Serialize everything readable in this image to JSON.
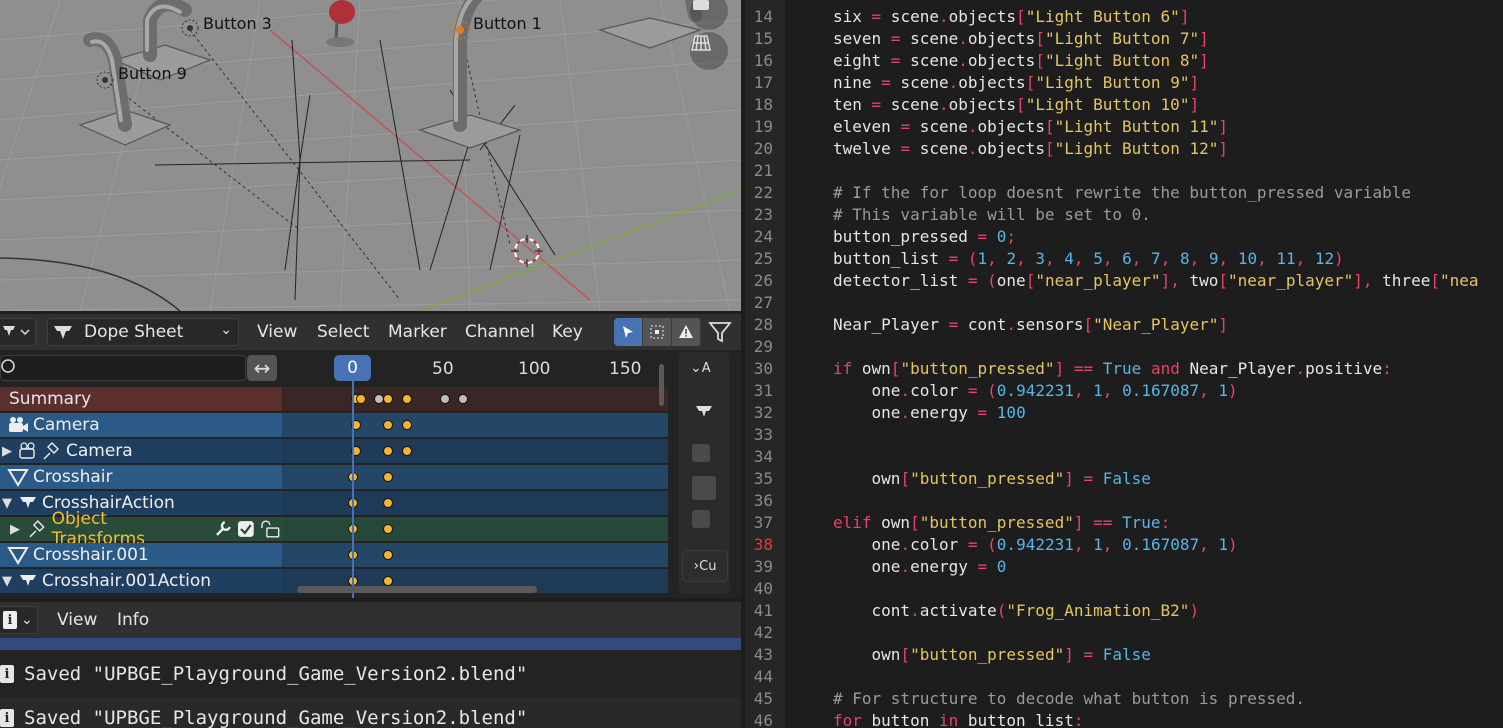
{
  "viewport": {
    "labels": [
      "Button 3",
      "Button 1",
      "Button 9"
    ]
  },
  "dope_sheet": {
    "editor_type_icon": "dope-sheet-icon",
    "mode_label": "Dope Sheet",
    "menus": [
      "View",
      "Select",
      "Marker",
      "Channel",
      "Key"
    ],
    "current_frame": "0",
    "frame_ticks": [
      "50",
      "100",
      "150"
    ],
    "channels": [
      {
        "label": "Summary",
        "kind": "summary"
      },
      {
        "label": "Camera",
        "kind": "object"
      },
      {
        "label": "Camera",
        "kind": "action"
      },
      {
        "label": "Crosshair",
        "kind": "object"
      },
      {
        "label": "CrosshairAction",
        "kind": "action"
      },
      {
        "label": "Object Transforms",
        "kind": "group"
      },
      {
        "label": "Crosshair.001",
        "kind": "object"
      },
      {
        "label": "Crosshair.001Action",
        "kind": "action"
      }
    ],
    "side_labels": [
      "A",
      "Cu"
    ]
  },
  "info_editor": {
    "menus": [
      "View",
      "Info"
    ],
    "messages": [
      "Saved \"UPBGE_Playground_Game_Version2.blend\"",
      "Saved \"UPBGE_Playground_Game_Version2.blend\""
    ]
  },
  "text_editor": {
    "current_line": 38,
    "lines": [
      {
        "n": "14",
        "text": "    six = scene.objects[\"Light Button 6\"]"
      },
      {
        "n": "15",
        "text": "    seven = scene.objects[\"Light Button 7\"]"
      },
      {
        "n": "16",
        "text": "    eight = scene.objects[\"Light Button 8\"]"
      },
      {
        "n": "17",
        "text": "    nine = scene.objects[\"Light Button 9\"]"
      },
      {
        "n": "18",
        "text": "    ten = scene.objects[\"Light Button 10\"]"
      },
      {
        "n": "19",
        "text": "    eleven = scene.objects[\"Light Button 11\"]"
      },
      {
        "n": "20",
        "text": "    twelve = scene.objects[\"Light Button 12\"]"
      },
      {
        "n": "21",
        "text": ""
      },
      {
        "n": "22",
        "text": "    # If the for loop doesnt rewrite the button_pressed variable"
      },
      {
        "n": "23",
        "text": "    # This variable will be set to 0."
      },
      {
        "n": "24",
        "text": "    button_pressed = 0;"
      },
      {
        "n": "25",
        "text": "    button_list = (1, 2, 3, 4, 5, 6, 7, 8, 9, 10, 11, 12)"
      },
      {
        "n": "26",
        "text": "    detector_list = (one[\"near_player\"], two[\"near_player\"], three[\"nea"
      },
      {
        "n": "27",
        "text": ""
      },
      {
        "n": "28",
        "text": "    Near_Player = cont.sensors[\"Near_Player\"]"
      },
      {
        "n": "29",
        "text": ""
      },
      {
        "n": "30",
        "text": "    if own[\"button_pressed\"] == True and Near_Player.positive:"
      },
      {
        "n": "31",
        "text": "        one.color = (0.942231, 1, 0.167087, 1)"
      },
      {
        "n": "32",
        "text": "        one.energy = 100"
      },
      {
        "n": "33",
        "text": ""
      },
      {
        "n": "34",
        "text": ""
      },
      {
        "n": "35",
        "text": "        own[\"button_pressed\"] = False"
      },
      {
        "n": "36",
        "text": ""
      },
      {
        "n": "37",
        "text": "    elif own[\"button_pressed\"] == True:"
      },
      {
        "n": "38",
        "text": "        one.color = (0.942231, 1, 0.167087, 1)"
      },
      {
        "n": "39",
        "text": "        one.energy = 0"
      },
      {
        "n": "40",
        "text": ""
      },
      {
        "n": "41",
        "text": "        cont.activate(\"Frog_Animation_B2\")"
      },
      {
        "n": "42",
        "text": ""
      },
      {
        "n": "43",
        "text": "        own[\"button_pressed\"] = False"
      },
      {
        "n": "44",
        "text": ""
      },
      {
        "n": "45",
        "text": "    # For structure to decode what button is pressed."
      },
      {
        "n": "46",
        "text": "    for button in button_list:"
      }
    ]
  },
  "colors": {
    "accent": "#4772b3",
    "keyframe": "#f2b431",
    "string": "#e5c55f",
    "number": "#55b6e8",
    "keyword": "#ea4268"
  }
}
